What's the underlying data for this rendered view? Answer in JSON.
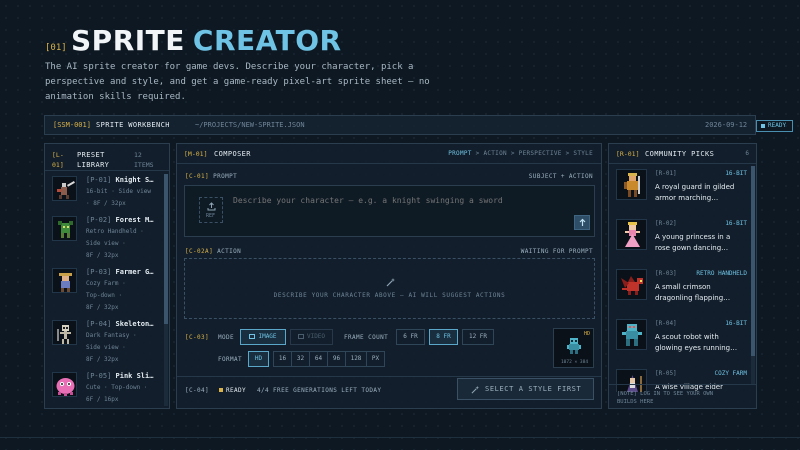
{
  "hero": {
    "tag": "[01]",
    "title_part1": "SPRITE",
    "title_part2": "CREATOR",
    "description": "The AI sprite creator for game devs. Describe your character, pick a perspective and style, and get a game-ready pixel-art sprite sheet — no animation skills required."
  },
  "workbench": {
    "code": "[SSM-001]",
    "title": "SPRITE WORKBENCH",
    "path": "~/PROJECTS/NEW-SPRITE.JSON",
    "date": "2026-09-12",
    "status": "READY"
  },
  "library": {
    "code_line1": "[L-",
    "code_line2": "01]",
    "title_line1": "PRESET",
    "title_line2": "LIBRARY",
    "count_line1": "12",
    "count_line2": "ITEMS",
    "items": [
      {
        "code": "[P-01]",
        "name": "Knight S…",
        "line2": "16-bit · Side view",
        "line3": "· 8F / 32px",
        "line4": "",
        "icon": "knight-sprite-icon"
      },
      {
        "code": "[P-02]",
        "name": "Forest M…",
        "line2": "Retro Handheld ·",
        "line3": "Side view ·",
        "line4": "8F / 32px",
        "icon": "forest-monster-sprite-icon"
      },
      {
        "code": "[P-03]",
        "name": "Farmer G…",
        "line2": "Cozy Farm ·",
        "line3": "Top-down ·",
        "line4": "8F / 32px",
        "icon": "farmer-sprite-icon"
      },
      {
        "code": "[P-04]",
        "name": "Skeleton…",
        "line2": "Dark Fantasy ·",
        "line3": "Side view ·",
        "line4": "8F / 32px",
        "icon": "skeleton-sprite-icon"
      },
      {
        "code": "[P-05]",
        "name": "Pink Sli…",
        "line2": "Cute · Top-down ·",
        "line3": "6F / 16px",
        "line4": "",
        "icon": "pink-slime-sprite-icon"
      }
    ]
  },
  "composer": {
    "code": "[M-01]",
    "title": "COMPOSER",
    "steps": {
      "active": "PROMPT",
      "rest": "> ACTION > PERSPECTIVE > STYLE"
    },
    "prompt": {
      "code": "[C-01]",
      "label": "PROMPT",
      "hint": "SUBJECT + ACTION",
      "ref_label": "REF",
      "placeholder": "Describe your character — e.g. a knight swinging a sword"
    },
    "action": {
      "code": "[C-02A]",
      "label": "ACTION",
      "status": "WAITING FOR PROMPT",
      "empty_text": "DESCRIBE YOUR CHARACTER ABOVE — AI WILL SUGGEST ACTIONS"
    },
    "mode": {
      "code": "[C-03]",
      "label": "MODE",
      "options": [
        "IMAGE",
        "VIDEO"
      ],
      "selected": "IMAGE"
    },
    "frame_count": {
      "label": "FRAME COUNT",
      "options": [
        "6 FR",
        "8 FR",
        "12 FR"
      ],
      "selected": "8 FR"
    },
    "format": {
      "label": "FORMAT",
      "options": [
        "HD",
        "16",
        "32",
        "64",
        "96",
        "128",
        "PX"
      ],
      "selected": "HD"
    },
    "preview": {
      "badge": "HD",
      "size": "1072 × 384"
    },
    "footer": {
      "code": "[C-04]",
      "status": "READY",
      "credits": "4/4 FREE GENERATIONS LEFT TODAY",
      "cta": "SELECT A STYLE FIRST"
    }
  },
  "community": {
    "code": "[R-01]",
    "title": "COMMUNITY PICKS",
    "count": "6",
    "items": [
      {
        "code": "[R-01]",
        "tag": "16-BIT",
        "desc": "A royal guard in gilded armor marching…"
      },
      {
        "code": "[R-02]",
        "tag": "16-BIT",
        "desc": "A young princess in a rose gown dancing…"
      },
      {
        "code": "[R-03]",
        "tag": "RETRO HANDHELD",
        "desc": "A small crimson dragonling flapping…"
      },
      {
        "code": "[R-04]",
        "tag": "16-BIT",
        "desc": "A scout robot with glowing eyes running…"
      },
      {
        "code": "[R-05]",
        "tag": "COZY FARM",
        "desc": "A wise village elder leaning on a wooden…"
      }
    ],
    "footer_line1": "[NOTE] LOG IN TO SEE YOUR OWN",
    "footer_line2": "BUILDS HERE"
  },
  "colors": {
    "accent": "#6fc3e4",
    "highlight": "#d8b24a",
    "background": "#0d1822"
  }
}
